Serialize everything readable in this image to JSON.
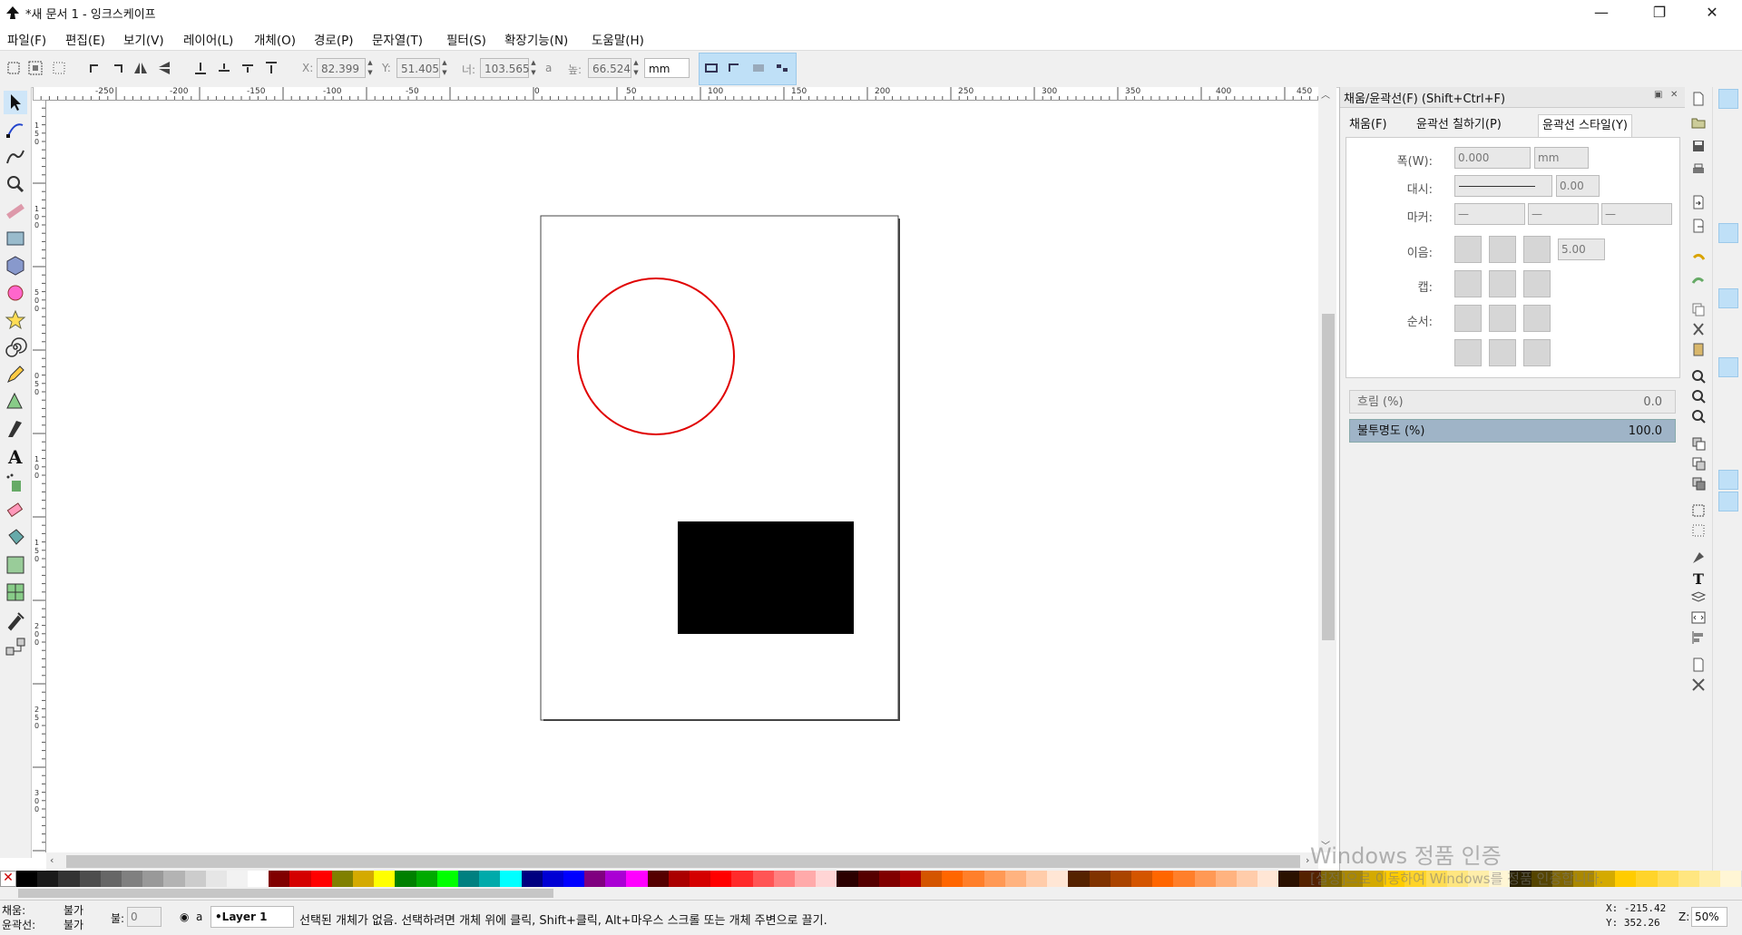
{
  "window": {
    "title": "*새 문서 1 - 잉크스케이프",
    "minimize": "—",
    "maximize": "❐",
    "close": "✕"
  },
  "menu": [
    "파일(F)",
    "편집(E)",
    "보기(V)",
    "레이어(L)",
    "개체(O)",
    "경로(P)",
    "문자열(T)",
    "필터(S)",
    "확장기능(N)",
    "도움말(H)"
  ],
  "toolctrl": {
    "x_label": "X:",
    "x_value": "82.399",
    "y_label": "Y:",
    "y_value": "51.405",
    "w_label": "너:",
    "w_value": "103.565",
    "lock": "a",
    "h_label": "높:",
    "h_value": "66.524",
    "unit": "mm"
  },
  "ruler_h": [
    "-250",
    "-200",
    "-150",
    "-100",
    "-50",
    "0",
    "50",
    "100",
    "150",
    "200",
    "250",
    "300",
    "350",
    "400",
    "450"
  ],
  "ruler_v": [
    "1",
    "5",
    "0",
    "1",
    "0",
    "0",
    "5",
    "0",
    "0",
    "0",
    "5",
    "0",
    "1",
    "0",
    "0",
    "1",
    "5",
    "0",
    "2",
    "0",
    "0",
    "2",
    "5",
    "0",
    "3",
    "0",
    "0",
    "3",
    "5",
    "0"
  ],
  "canvas": {
    "circle_stroke": "#e00000",
    "rect_fill": "#000000"
  },
  "dock": {
    "title": "채움/윤곽선(F) (Shift+Ctrl+F)",
    "tabs": [
      "채움(F)",
      "윤곽선 칠하기(P)",
      "윤곽선 스타일(Y)"
    ],
    "width_label": "폭(W):",
    "width_value": "0.000",
    "width_unit": "mm",
    "dash_label": "대시:",
    "dash_value": "0.00",
    "marker_label": "마커:",
    "marker_values": [
      "—",
      "—",
      "—"
    ],
    "join_label": "이음:",
    "join_value": "5.00",
    "cap_label": "캡:",
    "order_label": "순서:",
    "blur_label": "흐림 (%)",
    "blur_value": "0.0",
    "opacity_label": "불투명도 (%)",
    "opacity_value": "100.0"
  },
  "palette": [
    "#000000",
    "#1a1a1a",
    "#333333",
    "#4d4d4d",
    "#666666",
    "#808080",
    "#999999",
    "#b3b3b3",
    "#cccccc",
    "#e6e6e6",
    "#f2f2f2",
    "#ffffff",
    "#800000",
    "#d40000",
    "#ff0000",
    "#808000",
    "#d4aa00",
    "#ffff00",
    "#008000",
    "#00aa00",
    "#00ff00",
    "#008080",
    "#00aaaa",
    "#00ffff",
    "#000080",
    "#0000d4",
    "#0000ff",
    "#800080",
    "#aa00d4",
    "#ff00ff",
    "#550000",
    "#aa0000",
    "#d40000",
    "#ff0000",
    "#ff2a2a",
    "#ff5555",
    "#ff8080",
    "#ffaaaa",
    "#ffd5d5",
    "#2b0000",
    "#550000",
    "#800000",
    "#aa0000",
    "#d45500",
    "#ff6600",
    "#ff7f2a",
    "#ff9955",
    "#ffb380",
    "#ffccaa",
    "#ffe6d5",
    "#552200",
    "#803300",
    "#aa4400",
    "#d45500",
    "#ff6600",
    "#ff7f2a",
    "#ff9955",
    "#ffb380",
    "#ffccaa",
    "#ffe6d5",
    "#2b1100",
    "#552200",
    "#806600",
    "#aa8800",
    "#d4aa00",
    "#ffcc00",
    "#ffd42a",
    "#ffdd55",
    "#ffe680",
    "#ffeeaa",
    "#fff6d5",
    "#2b2200",
    "#554400",
    "#806600",
    "#aa8800",
    "#d4aa00",
    "#ffcc00",
    "#ffd42a",
    "#ffdd55",
    "#ffe680",
    "#ffeeaa",
    "#fff6d5"
  ],
  "status": {
    "fill_label": "채움:",
    "fill_value": "불가",
    "stroke_label": "윤곽선:",
    "stroke_value": "불가",
    "opacity_label": "불:",
    "opacity_value": "0",
    "layer": "•Layer 1",
    "message": "선택된 개체가 없음. 선택하려면 개체 위에 클릭, Shift+클릭, Alt+마우스 스크롤 또는 개체 주변으로 끌기.",
    "x_readout": "X: -215.42",
    "y_readout": "Y:  352.26",
    "zoom_label": "Z:",
    "zoom_value": "50%"
  },
  "watermark": {
    "line1": "Windows 정품 인증",
    "line2": "[설정]으로 이동하여 Windows를 정품 인증합니다."
  }
}
